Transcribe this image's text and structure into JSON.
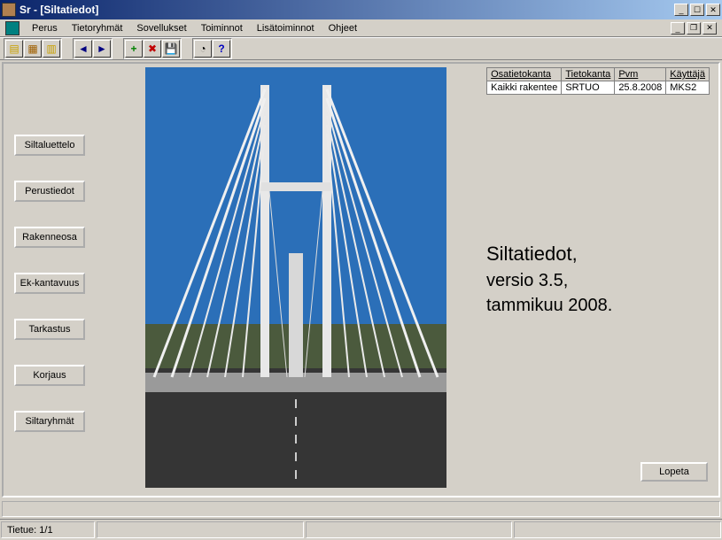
{
  "title": "Sr - [Siltatiedot]",
  "menu": {
    "perus": "Perus",
    "tietoryhmat": "Tietoryhmät",
    "sovellukset": "Sovellukset",
    "toiminnot": "Toiminnot",
    "lisatoiminnot": "Lisätoiminnot",
    "ohjeet": "Ohjeet"
  },
  "sidebar": {
    "siltaluettelo": "Siltaluettelo",
    "perustiedot": "Perustiedot",
    "rakenneosa": "Rakenneosa",
    "ekkantavuus": "Ek-kantavuus",
    "tarkastus": "Tarkastus",
    "korjaus": "Korjaus",
    "siltaryhmat": "Siltaryhmät"
  },
  "info": {
    "headers": {
      "osatietokanta": "Osatietokanta",
      "tietokanta": "Tietokanta",
      "pvm": "Pvm",
      "kayttaja": "Käyttäjä"
    },
    "row": {
      "osatietokanta": "Kaikki rakentee",
      "tietokanta": "SRTUO",
      "pvm": "25.8.2008",
      "kayttaja": "MKS2"
    }
  },
  "version": {
    "title": "Siltatiedot,",
    "line1": "versio 3.5,",
    "line2": "tammikuu 2008."
  },
  "quit": "Lopeta",
  "status": {
    "tietue": "Tietue: 1/1"
  },
  "icons": {
    "minimize": "_",
    "maximize": "☐",
    "close": "✕",
    "restore": "❐",
    "left": "◄",
    "right": "►",
    "plus": "+",
    "x": "✖",
    "save": "💾",
    "gauge": "◔",
    "help": "?"
  }
}
